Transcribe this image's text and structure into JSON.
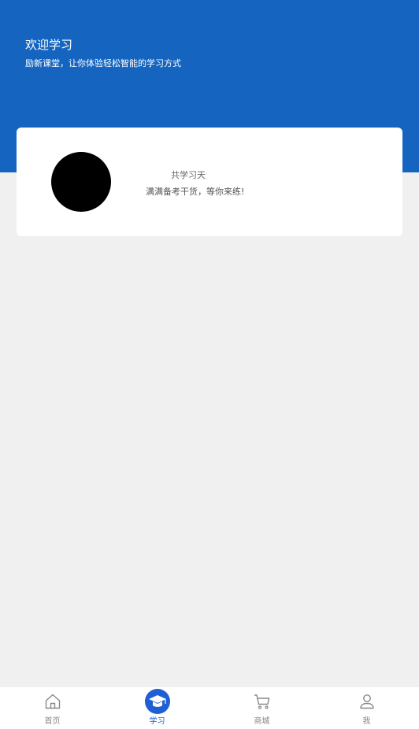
{
  "header": {
    "title": "欢迎学习",
    "subtitle": "励新课堂，让你体验轻松智能的学习方式",
    "bg_color": "#1565c0"
  },
  "card": {
    "study_days_text": "共学习天",
    "tagline": "满满备考干货，等你来练!"
  },
  "tabbar": {
    "active_color": "#1e5fd6",
    "items": [
      {
        "label": "首页",
        "icon": "home-icon",
        "active": false
      },
      {
        "label": "学习",
        "icon": "graduation-cap-icon",
        "active": true
      },
      {
        "label": "商城",
        "icon": "cart-icon",
        "active": false
      },
      {
        "label": "我",
        "icon": "user-icon",
        "active": false
      }
    ]
  }
}
